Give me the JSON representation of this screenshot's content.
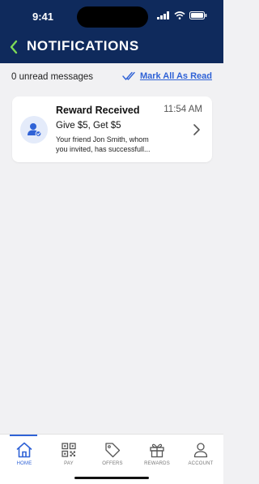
{
  "status_bar": {
    "time": "9:41"
  },
  "header": {
    "title": "NOTIFICATIONS"
  },
  "summary": {
    "unread_text": "0 unread messages",
    "mark_all_label": "Mark All As Read"
  },
  "notifications": [
    {
      "title": "Reward Received",
      "time": "11:54 AM",
      "subtitle": "Give $5, Get $5",
      "body_lines": [
        "Your friend Jon Smith, whom",
        "you invited, has successfull..."
      ]
    }
  ],
  "bottom_nav": {
    "items": [
      {
        "label": "HOME",
        "icon": "home-icon",
        "active": true
      },
      {
        "label": "PAY",
        "icon": "qr-code-icon",
        "active": false
      },
      {
        "label": "OFFERS",
        "icon": "tag-icon",
        "active": false
      },
      {
        "label": "REWARDS",
        "icon": "gift-icon",
        "active": false
      },
      {
        "label": "ACCOUNT",
        "icon": "person-icon",
        "active": false
      }
    ]
  },
  "colors": {
    "header_bg": "#0f2a5c",
    "accent": "#2f62d6",
    "page_bg": "#f1f1f3"
  }
}
